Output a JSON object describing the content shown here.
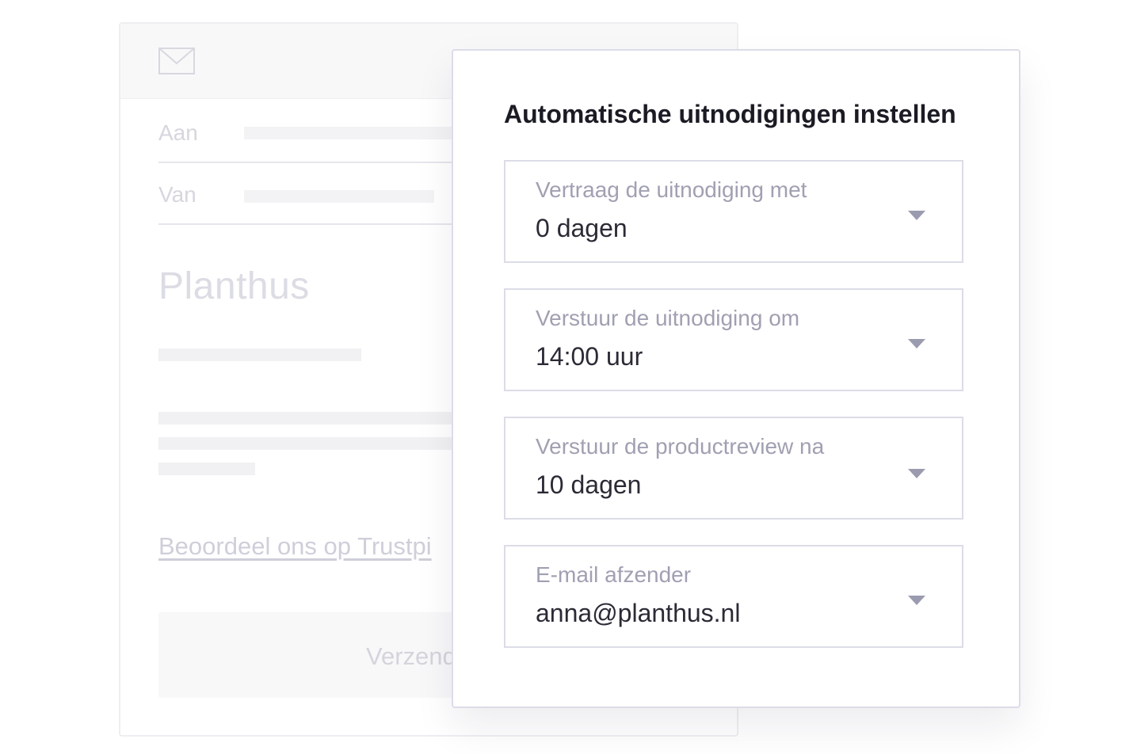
{
  "email_preview": {
    "to_label": "Aan",
    "from_label": "Van",
    "brand_name": "Planthus",
    "review_link": "Beoordeel ons op Trustpi",
    "send_button": "Verzend"
  },
  "settings_panel": {
    "title": "Automatische uitnodigingen instellen",
    "fields": [
      {
        "label": "Vertraag de uitnodiging met",
        "value": "0 dagen"
      },
      {
        "label": "Verstuur de uitnodiging om",
        "value": "14:00 uur"
      },
      {
        "label": "Verstuur de productreview na",
        "value": "10 dagen"
      },
      {
        "label": "E-mail afzender",
        "value": "anna@planthus.nl"
      }
    ]
  },
  "colors": {
    "panel_border": "#dcdce8",
    "label_text": "#a0a0b2",
    "value_text": "#2b2b36",
    "title_text": "#1b1b24"
  },
  "icons": [
    "envelope-icon",
    "chevron-down-icon"
  ]
}
